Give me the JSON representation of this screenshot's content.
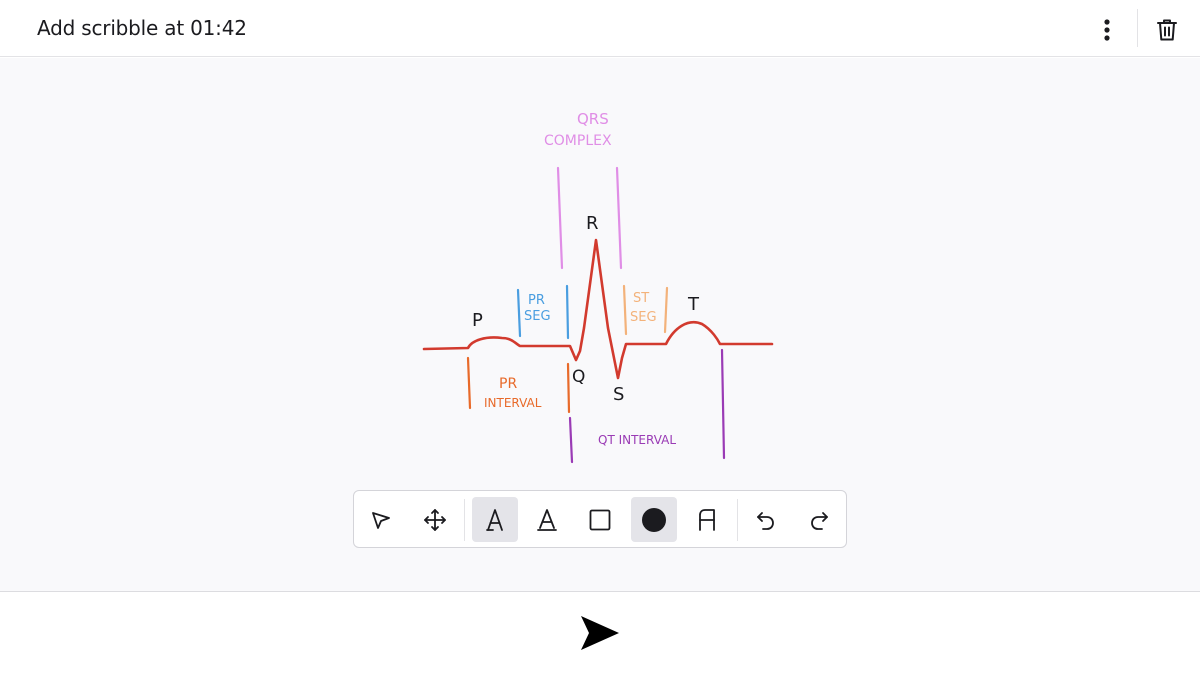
{
  "header": {
    "title": "Add scribble at 01:42",
    "more_icon": "more-vertical-icon",
    "delete_icon": "trash-icon"
  },
  "drawing": {
    "labels": {
      "qrs_line1": "QRS",
      "qrs_line2": "COMPLEX",
      "r": "R",
      "p": "P",
      "t": "T",
      "q": "Q",
      "s": "S",
      "pr_seg_line1": "PR",
      "pr_seg_line2": "SEG",
      "st_seg_line1": "ST",
      "st_seg_line2": "SEG",
      "pr_int_line1": "PR",
      "pr_int_line2": "INTERVAL",
      "qt_interval": "QT INTERVAL"
    },
    "colors": {
      "wave": "#d23a2e",
      "qrs": "#e08ee6",
      "pr_seg": "#4a9ee0",
      "st_seg": "#f3b27a",
      "pr_interval": "#e86a2a",
      "qt_interval": "#9a3bb5",
      "letters": "#1b1b1f"
    }
  },
  "toolbar": {
    "tools": [
      {
        "name": "select-tool",
        "icon": "pointer-icon",
        "active": false
      },
      {
        "name": "move-tool",
        "icon": "move-icon",
        "active": false
      },
      {
        "name": "text-tool",
        "icon": "text-a-icon",
        "active": true
      },
      {
        "name": "text-outline-tool",
        "icon": "text-outline-icon",
        "active": false
      },
      {
        "name": "rectangle-tool",
        "icon": "square-icon",
        "active": false
      },
      {
        "name": "color-tool",
        "icon": "color-circle-icon",
        "active": true
      },
      {
        "name": "font-tool",
        "icon": "font-icon",
        "active": false
      },
      {
        "name": "undo-tool",
        "icon": "undo-icon",
        "active": false
      },
      {
        "name": "redo-tool",
        "icon": "redo-icon",
        "active": false
      }
    ],
    "selected_color": "#1b1b1f"
  },
  "footer": {
    "send_icon": "send-icon"
  }
}
